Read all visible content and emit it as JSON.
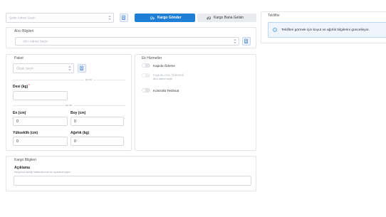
{
  "branch": {
    "placeholder": "Şube Adresi Seçin"
  },
  "tabs": [
    {
      "label": "Kargo Gönder",
      "active": true
    },
    {
      "label": "Kargo Bana Gelsin",
      "active": false
    }
  ],
  "recipient": {
    "title": "Alıcı Bilgileri",
    "placeholder": "Alıcı Adresi Seçin"
  },
  "package": {
    "title": "Paket",
    "select_placeholder": "Ölçek Seçin",
    "or_label": "ya da",
    "desi_label": "Desi (kg)",
    "required_mark": "*",
    "dimensions": {
      "en_label": "En (cm)",
      "en_value": "0",
      "boy_label": "Boy (cm)",
      "boy_value": "0",
      "yukseklik_label": "Yükseklik (cm)",
      "yukseklik_value": "0",
      "agirlik_label": "Ağırlık (kg)",
      "agirlik_value": "0"
    }
  },
  "extras": {
    "title": "Ek Hizmetler",
    "items": [
      {
        "label": "Kapıda Ödeme",
        "hint": "",
        "disabled": false
      },
      {
        "label": "Kapıda Alıcı Ödemeli",
        "hint": "Alıcı adresi seçin",
        "disabled": true
      },
      {
        "label": "Kontrollü Teslimat",
        "hint": "",
        "disabled": false
      }
    ]
  },
  "cargo_info": {
    "title": "Kargo Bilgileri",
    "description_label": "Açıklama",
    "description_hint": "Kargonun içeriği hakkında kısa bir açıklama yapın"
  },
  "offers": {
    "title": "Teklifler",
    "info_text": "Teklifleri görmek için boyut ve ağırlık bilgilerini güncelleyin."
  },
  "colors": {
    "accent": "#1f7fd6",
    "tab_inactive": "#e9ebee",
    "info_bg": "#eef5fd",
    "info_border": "#b9d6f2"
  }
}
